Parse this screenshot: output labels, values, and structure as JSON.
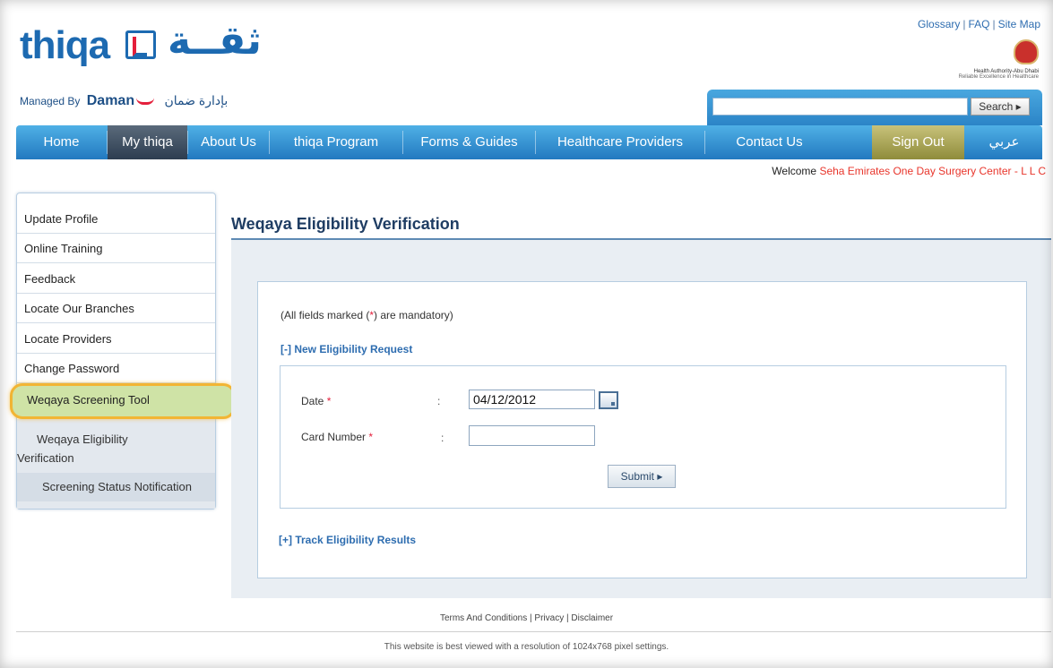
{
  "header": {
    "logo_text": "thiqa",
    "logo_arabic": "ثقــة",
    "managed_by": "Managed By",
    "managed_brand": "Daman",
    "managed_brand_arabic": "بإدارة ضمان",
    "top_links": [
      "Glossary",
      "FAQ",
      "Site Map"
    ],
    "authority_line1": "Health Authority-Abu Dhabi",
    "authority_line2": "Reliable Excellence in Healthcare"
  },
  "search": {
    "placeholder": "",
    "button_label": "Search ▸"
  },
  "nav": {
    "items": [
      {
        "label": "Home"
      },
      {
        "label": "My thiqa"
      },
      {
        "label": "About Us"
      },
      {
        "label": "thiqa Program"
      },
      {
        "label": "Forms & Guides"
      },
      {
        "label": "Healthcare Providers"
      },
      {
        "label": "Contact Us"
      },
      {
        "label": "Sign Out"
      },
      {
        "label": "عربي"
      }
    ],
    "active": "My thiqa"
  },
  "welcome": {
    "prefix": "Welcome",
    "name": "Seha Emirates One Day Surgery Center - L L C"
  },
  "sidebar": {
    "items": [
      {
        "label": "Update Profile"
      },
      {
        "label": "Online Training"
      },
      {
        "label": "Feedback"
      },
      {
        "label": "Locate Our Branches"
      },
      {
        "label": "Locate Providers"
      },
      {
        "label": "Change Password"
      },
      {
        "label": "Weqaya Screening Tool"
      }
    ],
    "sub_items": {
      "eligibility_line1": "Weqaya Eligibility",
      "eligibility_line2": "Verification",
      "screening_status": "Screening Status Notification"
    }
  },
  "main": {
    "title": "Weqaya Eligibility Verification",
    "mandatory_prefix": "(All fields marked (",
    "mandatory_star": "*",
    "mandatory_suffix": ") are mandatory)",
    "new_request": "[-] New Eligibility Request",
    "form": {
      "date_label": "Date",
      "date_value": "04/12/2012",
      "card_label": "Card Number",
      "card_value": "",
      "required_mark": "*",
      "colon": ":",
      "submit_label": "Submit ▸"
    },
    "track_results": "[+] Track Eligibility Results"
  },
  "footer": {
    "links": [
      "Terms And Conditions",
      "Privacy",
      "Disclaimer"
    ],
    "note": "This website is best viewed with a resolution of 1024x768 pixel settings."
  },
  "colors": {
    "nav_blue": "#2e8fd3",
    "link_blue": "#2e6db0",
    "required_red": "#e41f3b",
    "highlight_orange": "#f2b534",
    "highlight_green": "#cfe3a6",
    "signout_olive": "#a9a55a"
  }
}
